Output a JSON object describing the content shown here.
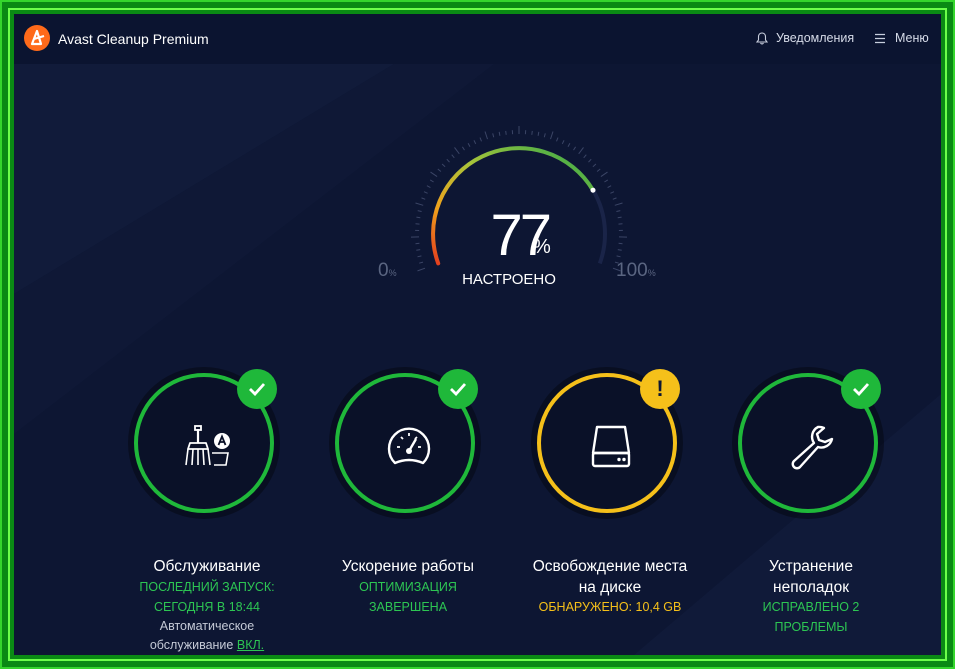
{
  "app": {
    "title": "Avast Cleanup Premium"
  },
  "header": {
    "notifications_label": "Уведомления",
    "menu_label": "Меню"
  },
  "gauge": {
    "value": 77,
    "value_text": "77",
    "percent_sign": "%",
    "status": "НАСТРОЕНО",
    "min_label": "0",
    "min_unit": "%",
    "max_label": "100",
    "max_unit": "%"
  },
  "colors": {
    "background": "#0d1633",
    "ok": "#1fb83a",
    "warning": "#f5c01a",
    "gauge_start": "#e23b1e",
    "gauge_end": "#2e8b3a"
  },
  "cards": [
    {
      "title": "Обслуживание",
      "status_line1": "ПОСЛЕДНИЙ ЗАПУСК:",
      "status_line2": "СЕГОДНЯ В 18:44",
      "note_line1": "Автоматическое",
      "note_line2_text": "обслуживание",
      "note_link": "ВКЛ.",
      "state": "ok",
      "icon": "broom-icon"
    },
    {
      "title": "Ускорение работы",
      "status_line1": "ОПТИМИЗАЦИЯ",
      "status_line2": "ЗАВЕРШЕНА",
      "state": "ok",
      "icon": "speedometer-icon"
    },
    {
      "title_line1": "Освобождение места",
      "title_line2": "на диске",
      "status_line1": "ОБНАРУЖЕНО: 10,4 GB",
      "state": "warning",
      "icon": "hard-drive-icon"
    },
    {
      "title_line1": "Устранение",
      "title_line2": "неполадок",
      "status_line1": "ИСПРАВЛЕНО 2",
      "status_line2": "ПРОБЛЕМЫ",
      "state": "ok",
      "icon": "wrench-icon"
    }
  ]
}
